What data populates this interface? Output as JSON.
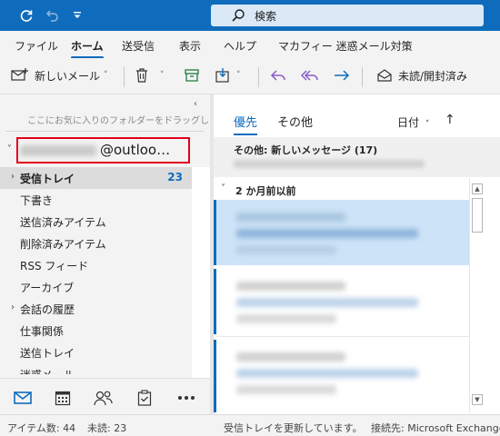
{
  "titlebar": {
    "search_placeholder": "検索"
  },
  "ribbon_tabs": [
    "ファイル",
    "ホーム",
    "送受信",
    "表示",
    "ヘルプ",
    "マカフィー 迷惑メール対策"
  ],
  "toolbar": {
    "new_mail_label": "新しいメール",
    "read_unread_label": "未読/開封済み"
  },
  "folder_pane": {
    "favorites_hint": "ここにお気に入りのフォルダーをドラッグします",
    "account_domain": "@outloo…",
    "folders": [
      {
        "label": "受信トレイ",
        "count": "23"
      },
      {
        "label": "下書き"
      },
      {
        "label": "送信済みアイテム"
      },
      {
        "label": "削除済みアイテム"
      },
      {
        "label": "RSS フィード"
      },
      {
        "label": "アーカイブ"
      },
      {
        "label": "会話の履歴"
      },
      {
        "label": "仕事関係"
      },
      {
        "label": "送信トレイ"
      },
      {
        "label": "迷惑メール"
      }
    ]
  },
  "message_list": {
    "tabs": [
      "優先",
      "その他"
    ],
    "sort_label": "日付",
    "other_banner_title": "その他: 新しいメッセージ (17)",
    "group_header": "2 か月前以前"
  },
  "statusbar": {
    "items_label": "アイテム数: 44",
    "unread_label": "未読: 23",
    "updating_label": "受信トレイを更新しています。",
    "connection_label": "接続先: Microsoft Exchange"
  },
  "colors": {
    "accent": "#0f6cbd",
    "highlight_box": "#e0001b",
    "selected_message": "#cde3f7"
  }
}
